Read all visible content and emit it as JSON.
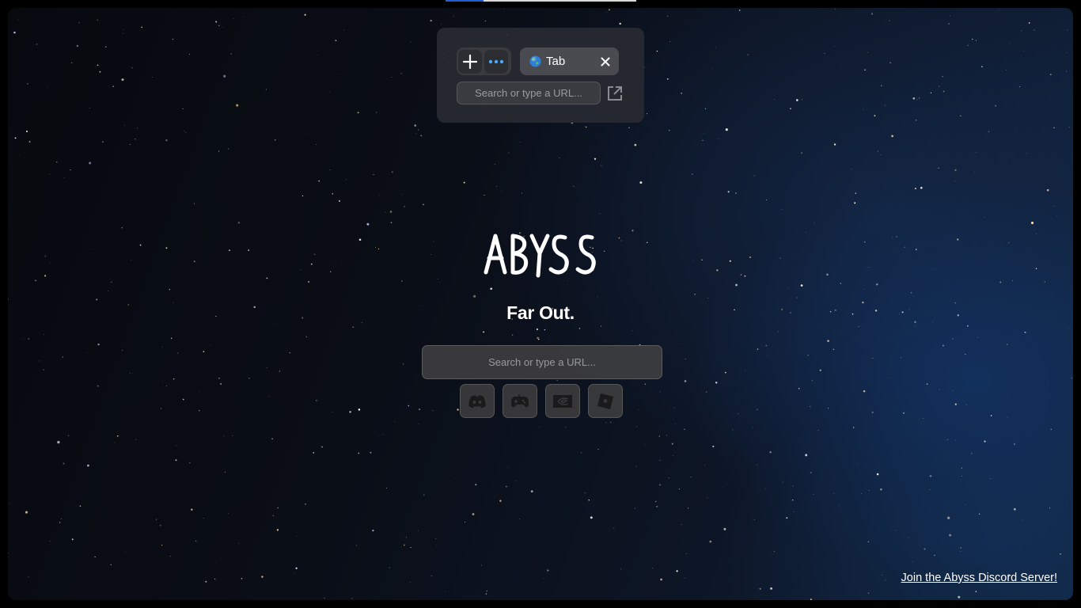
{
  "colors": {
    "accent": "#1f5fd0",
    "panel_bg": "#282a32",
    "dots_icon": "#4aa8ff"
  },
  "loading_progress": 0.2,
  "panel": {
    "add_tab_icon": "plus-icon",
    "menu_icon": "more-dots-icon",
    "tab": {
      "icon": "globe-icon",
      "label": "Tab",
      "close_icon": "close-icon"
    },
    "search_placeholder": "Search or type a URL...",
    "open_icon": "open-external-icon"
  },
  "hero": {
    "logo_text": "ABYSS",
    "tagline": "Far Out."
  },
  "search": {
    "placeholder": "Search or type a URL..."
  },
  "quick_links": [
    {
      "name": "discord",
      "icon": "discord-icon"
    },
    {
      "name": "games",
      "icon": "gamepad-icon"
    },
    {
      "name": "geforce-now",
      "icon": "nvidia-icon"
    },
    {
      "name": "roblox",
      "icon": "roblox-icon"
    }
  ],
  "footer": {
    "discord_link": "Join the Abyss Discord Server!"
  }
}
